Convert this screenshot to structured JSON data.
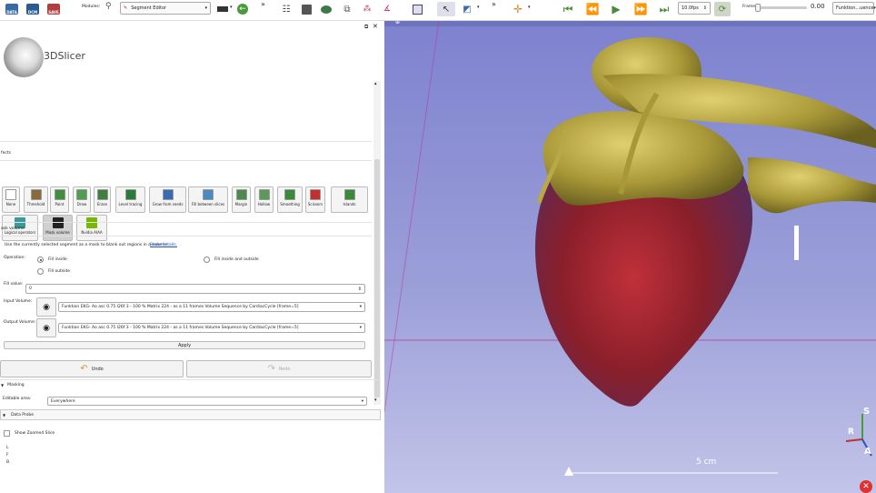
{
  "toolbar": {
    "data_label": "DATA",
    "dcm_label": "DCM",
    "save_label": "SAVE",
    "modules_label": "Modules:",
    "module_selected": "Segment Editor",
    "fps_value": "10.0fps",
    "frame_label": "Frame:",
    "frame_value": "0.00",
    "sequence_combo": "Funktion...uence"
  },
  "logo": {
    "text": "3DSlicer"
  },
  "panel": {
    "effects_label": "fects",
    "effects": [
      {
        "label": "None",
        "color": "#ffffff"
      },
      {
        "label": "Threshold",
        "color": "#8a6a3a"
      },
      {
        "label": "Paint",
        "color": "#3f8f3f"
      },
      {
        "label": "Draw",
        "color": "#4f9f4f"
      },
      {
        "label": "Erase",
        "color": "#3f7f3f"
      },
      {
        "label": "Level tracing",
        "color": "#2a7a3a"
      },
      {
        "label": "Grow from seeds",
        "color": "#3a6ab0"
      },
      {
        "label": "Fill between slices",
        "color": "#4a8ac0"
      },
      {
        "label": "Margin",
        "color": "#4a8a4a"
      },
      {
        "label": "Hollow",
        "color": "#5a9a5a"
      },
      {
        "label": "Smoothing",
        "color": "#3a8a3a"
      },
      {
        "label": "Scissors",
        "color": "#c03030"
      },
      {
        "label": "Islands",
        "color": "#3a8a3a"
      }
    ],
    "effects_row2": [
      {
        "label": "Logical operators",
        "color": "#3a9a9a"
      },
      {
        "label": "Mask volume",
        "color": "#222222"
      },
      {
        "label": "Nvidia AIAA",
        "color": "#76b900"
      }
    ],
    "section_title": "ask volume",
    "help_text": "Use the currently selected segment as a mask to blank out regions in a volume.",
    "show_details": "Show details.",
    "operation_label": "Operation:",
    "op_fill_inside": "Fill inside",
    "op_fill_inside_outside": "Fill inside and outside",
    "op_fill_outside": "Fill outside",
    "fill_value_label": "Fill value:",
    "fill_value": "0",
    "input_volume_label": "Input Volume:",
    "input_volume": "Funktion EKG- Ao asc 0.75 I26f 3 - 100 % Matrix 224 - as a 11 frames Volume Sequence by CardiacCycle [frame=5]",
    "output_volume_label": "Output Volume:",
    "output_volume": "Funktion EKG- Ao asc 0.75 I26f 3 - 100 % Matrix 224 - as a 11 frames Volume Sequence by CardiacCycle [frame=5]",
    "apply_label": "Apply",
    "undo_label": "Undo",
    "redo_label": "Redo",
    "masking_label": "Masking",
    "editable_area_label": "Editable area:",
    "editable_area_value": "Everywhere",
    "data_probe_label": "Data Probe",
    "show_zoomed_label": "Show Zoomed Slice",
    "probe_values": [
      "L",
      "F",
      "B"
    ]
  },
  "view": {
    "scale_label": "5 cm",
    "orient_s": "S",
    "orient_r": "R",
    "orient_a": "A"
  }
}
